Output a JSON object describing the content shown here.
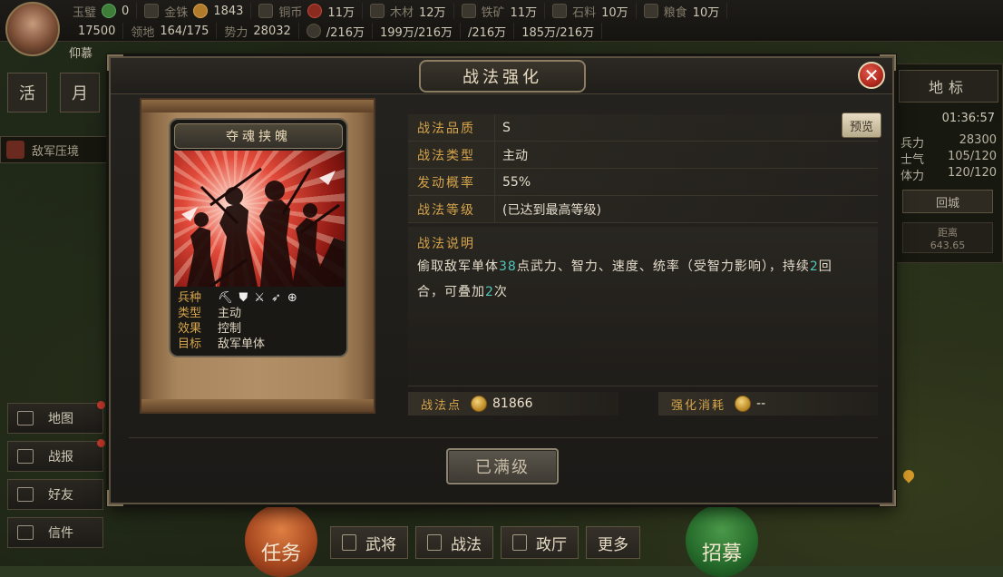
{
  "topbar": {
    "player_name": "仰慕",
    "row1": [
      {
        "label": "玉璧",
        "value": "0",
        "icon": "jade-icon"
      },
      {
        "label": "金铢",
        "value": "1843",
        "icon": "gold-coin-icon"
      },
      {
        "label": "铜币",
        "value": "11万",
        "icon": "copper-coin-icon"
      },
      {
        "label": "木材",
        "value": "12万",
        "icon": "wood-icon"
      },
      {
        "label": "铁矿",
        "value": "11万",
        "icon": "iron-icon"
      },
      {
        "label": "石料",
        "value": "10万",
        "icon": "stone-icon"
      },
      {
        "label": "粮食",
        "value": "10万",
        "icon": "grain-icon"
      }
    ],
    "row2": [
      {
        "label": "",
        "value": "17500"
      },
      {
        "label": "领地",
        "value": "164/175"
      },
      {
        "label": "势力",
        "value": "28032"
      },
      {
        "label": "",
        "value": "/216万"
      },
      {
        "label": "",
        "value": "199万/216万"
      },
      {
        "label": "",
        "value": "/216万"
      },
      {
        "label": "",
        "value": "185万/216万"
      }
    ]
  },
  "sidebar": {
    "diamonds": [
      "活",
      "月"
    ],
    "enemy_tag": "敌军压境",
    "menu": [
      {
        "label": "地图",
        "icon": "map-icon",
        "badge": true
      },
      {
        "label": "战报",
        "icon": "battle-report-icon",
        "badge": true
      },
      {
        "label": "好友",
        "icon": "friends-icon",
        "badge": false
      },
      {
        "label": "信件",
        "icon": "mail-icon",
        "badge": false
      }
    ]
  },
  "right_panel": {
    "tab": "地标",
    "clock": "01:36:57",
    "rows": [
      {
        "k": "兵力",
        "v": "28300"
      },
      {
        "k": "士气",
        "v": "105/120"
      },
      {
        "k": "体力",
        "v": "120/120"
      }
    ],
    "button": "回城",
    "note_line1": "距离",
    "note_line2": "643.65"
  },
  "bottom": {
    "left_round": "任务",
    "right_round": "招募",
    "tabs": [
      {
        "label": "武将",
        "icon": "general-icon"
      },
      {
        "label": "战法",
        "icon": "tactic-icon"
      },
      {
        "label": "政厅",
        "icon": "hall-icon"
      },
      {
        "label": "更多",
        "icon": ""
      }
    ]
  },
  "modal": {
    "title": "战法强化",
    "close": "✕",
    "card": {
      "name": "夺魂挟魄",
      "rows": [
        {
          "k": "兵种",
          "v": ""
        },
        {
          "k": "类型",
          "v": "主动"
        },
        {
          "k": "效果",
          "v": "控制"
        },
        {
          "k": "目标",
          "v": "敌军单体"
        }
      ],
      "troop_icons": [
        "⛏",
        "⛊",
        "⚔",
        "➶",
        "⊕"
      ]
    },
    "info": [
      {
        "k": "战法品质",
        "v": "S"
      },
      {
        "k": "战法类型",
        "v": "主动"
      },
      {
        "k": "发动概率",
        "v": "55%"
      },
      {
        "k": "战法等级",
        "v": "(已达到最高等级)"
      }
    ],
    "preview_button": "预览",
    "desc_title": "战法说明",
    "desc_parts": {
      "p1": "偷取敌军单体",
      "n1": "38",
      "p2": "点武力、智力、速度、统率（受智力影响），持续",
      "n2": "2",
      "p3": "回合，可叠加",
      "n3": "2",
      "p4": "次"
    },
    "points": {
      "label": "战法点",
      "value": "81866"
    },
    "cost": {
      "label": "强化消耗",
      "value": "--"
    },
    "max_button": "已满级"
  },
  "colors": {
    "accent_gold": "#d5a44a",
    "highlight_teal": "#4fc7b8",
    "close_red": "#c73a2c"
  }
}
